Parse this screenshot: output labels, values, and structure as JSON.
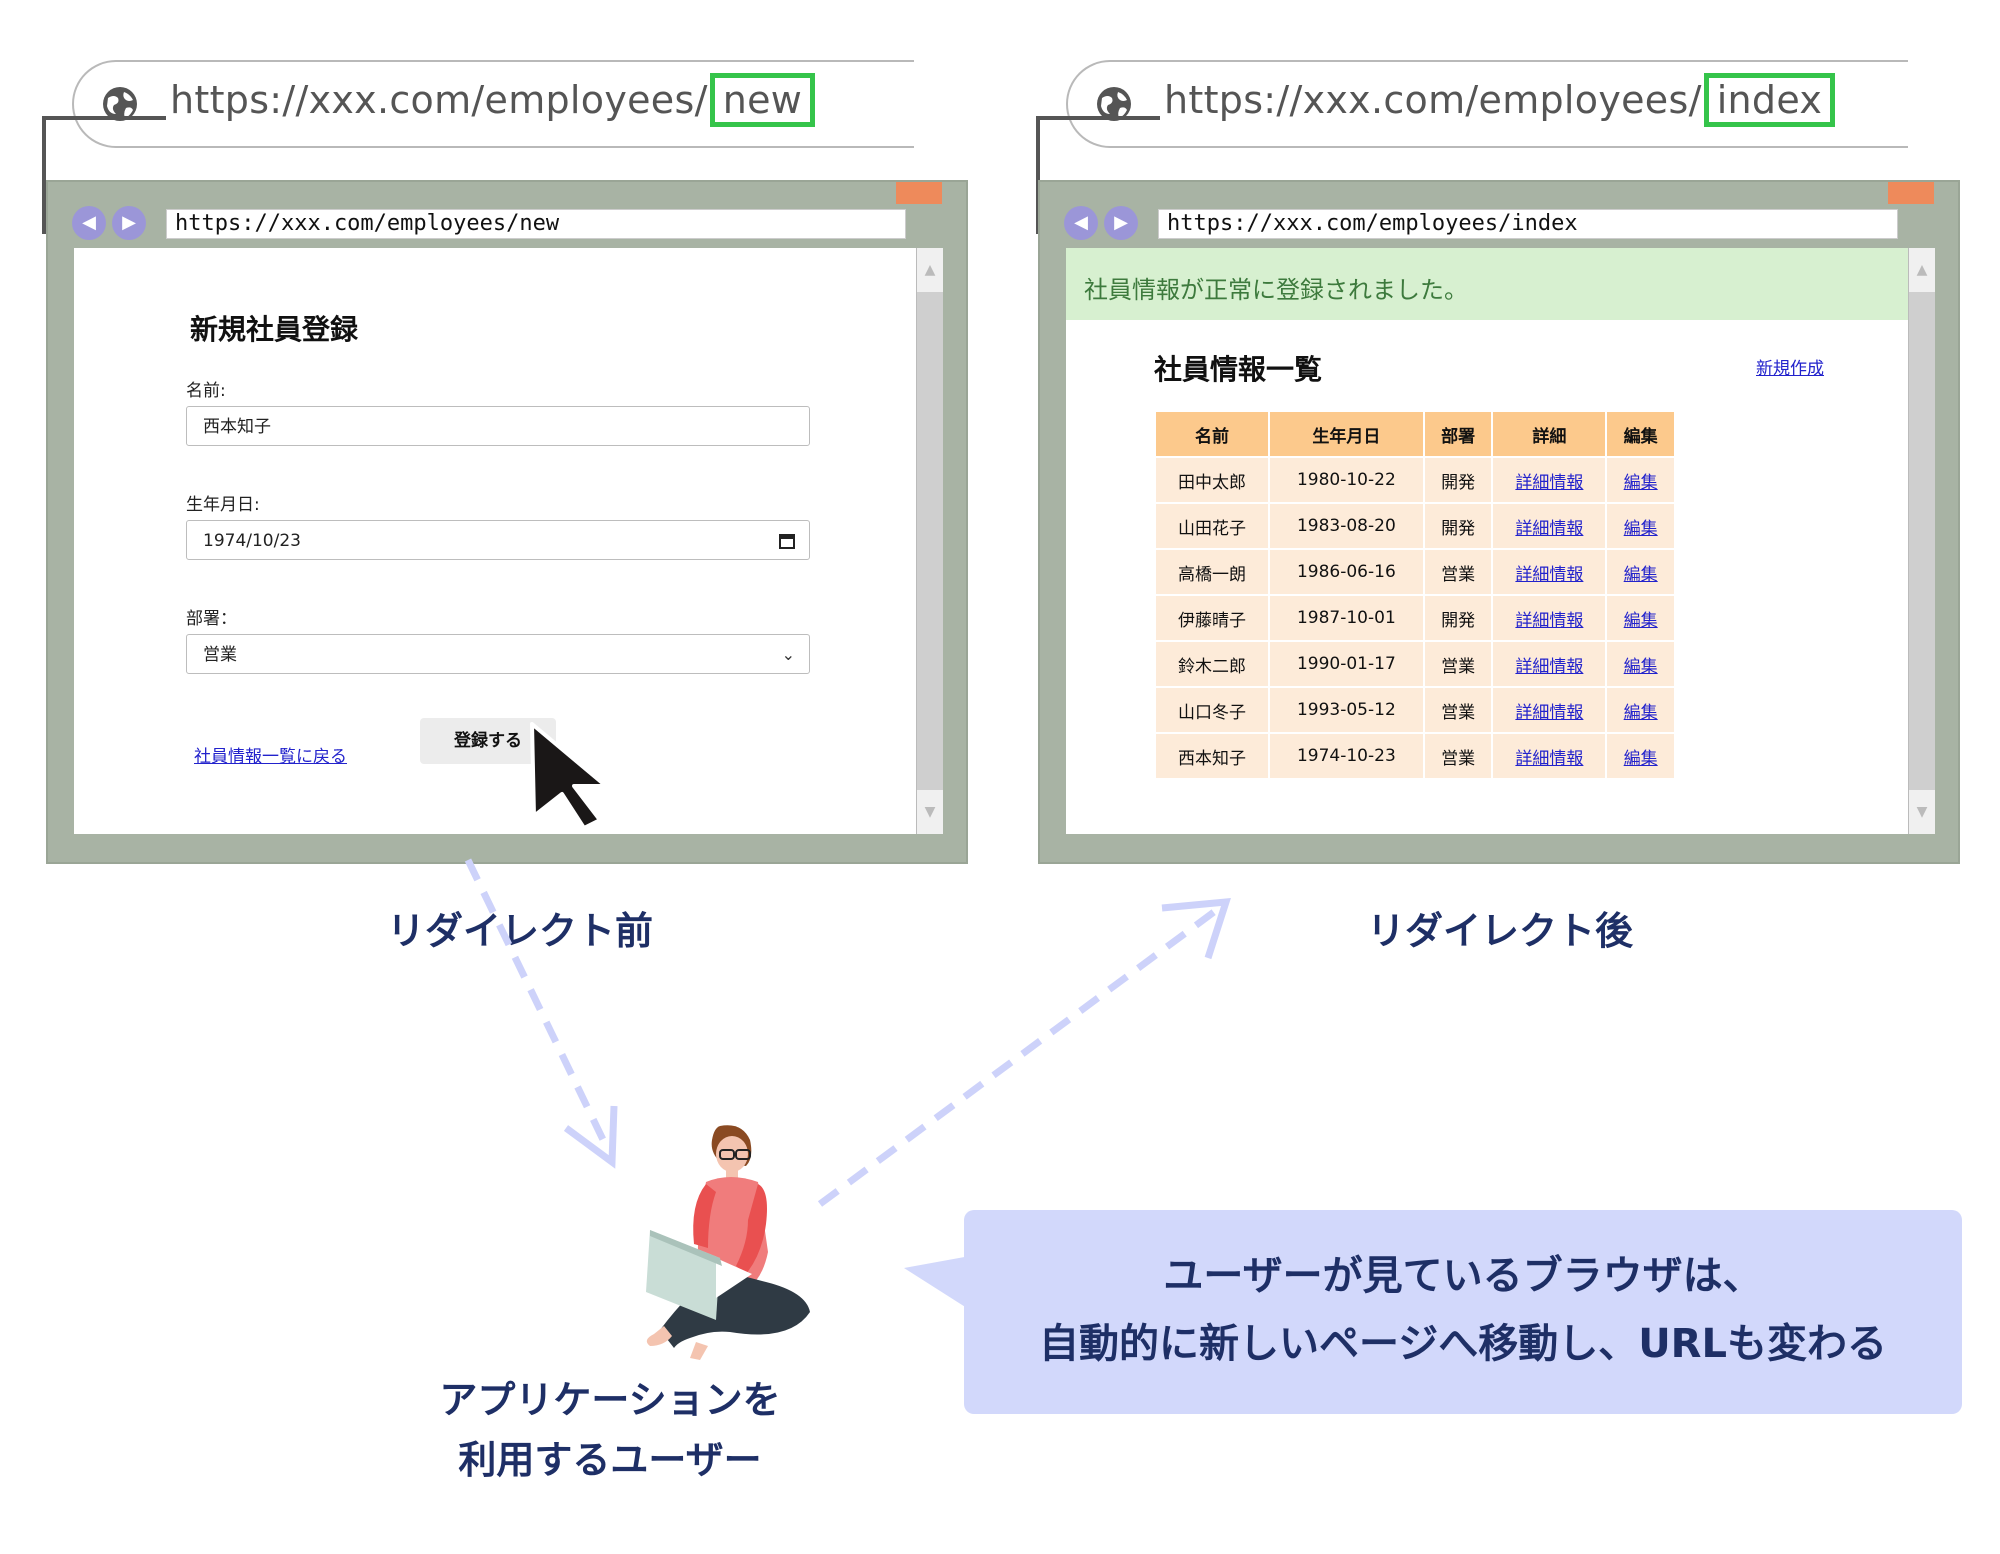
{
  "before": {
    "address_bar": {
      "url_prefix": "https://xxx.com/employees/",
      "url_highlight": "new"
    },
    "mini_url": "https://xxx.com/employees/new",
    "form": {
      "title": "新規社員登録",
      "name_label": "名前:",
      "name_value": "西本知子",
      "birth_label": "生年月日:",
      "birth_value": "1974/10/23",
      "dept_label": "部署：",
      "dept_value": "営業",
      "back_link": "社員情報一覧に戻る",
      "submit_label": "登録する"
    },
    "caption": "リダイレクト前"
  },
  "after": {
    "address_bar": {
      "url_prefix": "https://xxx.com/employees/",
      "url_highlight": "index"
    },
    "mini_url": "https://xxx.com/employees/index",
    "notice": "社員情報が正常に登録されました。",
    "list_title": "社員情報一覧",
    "new_link": "新規作成",
    "table": {
      "headers": [
        "名前",
        "生年月日",
        "部署",
        "詳細",
        "編集"
      ],
      "rows": [
        [
          "田中太郎",
          "1980-10-22",
          "開発",
          "詳細情報",
          "編集"
        ],
        [
          "山田花子",
          "1983-08-20",
          "開発",
          "詳細情報",
          "編集"
        ],
        [
          "高橋一朗",
          "1986-06-16",
          "営業",
          "詳細情報",
          "編集"
        ],
        [
          "伊藤晴子",
          "1987-10-01",
          "開発",
          "詳細情報",
          "編集"
        ],
        [
          "鈴木二郎",
          "1990-01-17",
          "営業",
          "詳細情報",
          "編集"
        ],
        [
          "山口冬子",
          "1993-05-12",
          "営業",
          "詳細情報",
          "編集"
        ],
        [
          "西本知子",
          "1974-10-23",
          "営業",
          "詳細情報",
          "編集"
        ]
      ]
    },
    "caption": "リダイレクト後"
  },
  "user_caption": {
    "line1": "アプリケーションを",
    "line2": "利用するユーザー"
  },
  "callout": {
    "line1": "ユーザーが見ているブラウザは、",
    "line2": "自動的に新しいページへ移動し、URLも変わる"
  },
  "icons": [
    "globe-icon",
    "back-arrow-icon",
    "forward-arrow-icon",
    "calendar-icon",
    "chevron-down-icon",
    "mouse-cursor-icon",
    "user-with-laptop-illustration"
  ],
  "colors": {
    "url_highlight": "#35c44a",
    "frame": "#a8b3a4",
    "close_button": "#ee8a5b",
    "nav_buttons": "#9b96d8",
    "notice_bg": "#d7f0d0",
    "table_header": "#fcc98c",
    "table_cell": "#fdebd9",
    "caption_text": "#1e2f66",
    "callout_bg": "#d2d8fb",
    "arrow": "#cdd2fa"
  }
}
